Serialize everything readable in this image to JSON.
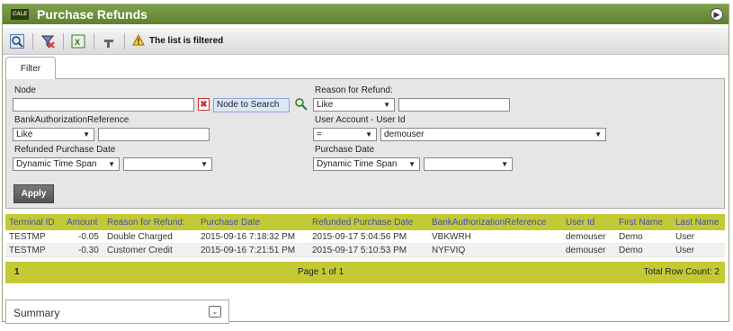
{
  "window": {
    "title": "Purchase Refunds",
    "logo_text": "CALE"
  },
  "toolbar": {
    "filtered_text": "The list is filtered"
  },
  "filter": {
    "tab_label": "Filter",
    "node_label": "Node",
    "node_search_placeholder": "Node to Search",
    "reason_label": "Reason for Refund:",
    "reason_op": "Like",
    "bank_label": "BankAuthorizationReference",
    "bank_op": "Like",
    "user_label": "User Account - User Id",
    "user_op": "=",
    "user_value": "demouser",
    "refunded_date_label": "Refunded Purchase Date",
    "refunded_date_mode": "Dynamic Time Span",
    "purchase_date_label": "Purchase Date",
    "purchase_date_mode": "Dynamic Time Span",
    "apply_label": "Apply"
  },
  "grid": {
    "columns": [
      "Terminal ID",
      "Amount",
      "Reason for Refund:",
      "Purchase Date",
      "Refunded Purchase Date",
      "BankAuthorizationReference",
      "User Id",
      "First Name",
      "Last Name"
    ],
    "rows": [
      [
        "TESTMP",
        "-0.05",
        "Double Charged",
        "2015-09-16 7:18:32 PM",
        "2015-09-17 5:04:56 PM",
        "VBKWRH",
        "demouser",
        "Demo",
        "User"
      ],
      [
        "TESTMP",
        "-0.30",
        "Customer Credit",
        "2015-09-16 7:21:51 PM",
        "2015-09-17 5:10:53 PM",
        "NYFVIQ",
        "demouser",
        "Demo",
        "User"
      ]
    ],
    "footer": {
      "page_number": "1",
      "page_info": "Page 1 of 1",
      "row_count": "Total Row Count: 2"
    }
  },
  "summary": {
    "label": "Summary"
  },
  "colors": {
    "title_green": "#6b8e3a",
    "grid_header": "#c4c936",
    "header_text": "#3d4fb0"
  }
}
